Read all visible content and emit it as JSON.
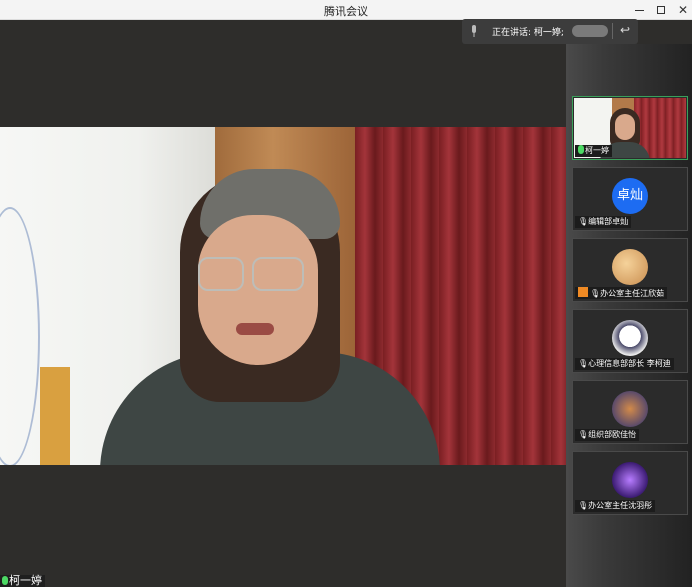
{
  "window": {
    "title": "腾讯会议"
  },
  "speaker_bar": {
    "label": "正在讲话: 柯一婷;"
  },
  "main_video": {
    "name": "柯一婷"
  },
  "participants": [
    {
      "name": "柯一婷",
      "type": "video",
      "active": true
    },
    {
      "name": "编辑部卓灿",
      "type": "text-avatar",
      "avatar_text": "卓灿"
    },
    {
      "name": "办公室主任江欣茹",
      "type": "photo-avatar",
      "host": true
    },
    {
      "name": "心理信息部部长 李柯迪",
      "type": "photo-avatar"
    },
    {
      "name": "组织部欧佳怡",
      "type": "photo-avatar"
    },
    {
      "name": "办公室主任沈羽彤",
      "type": "photo-avatar"
    }
  ],
  "colors": {
    "accent_blue": "#1d6cf2",
    "active_border": "#3aa05a",
    "host_orange": "#f08a24"
  }
}
